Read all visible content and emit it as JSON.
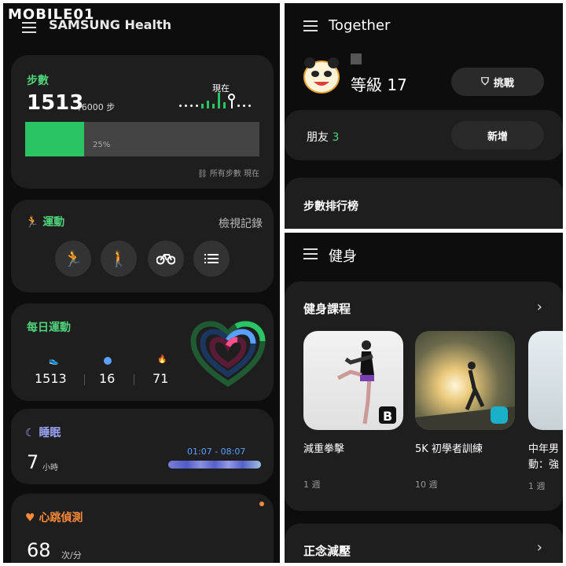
{
  "watermark": "MOBILE01",
  "left": {
    "brand": "SAMSUNG Health",
    "steps": {
      "title": "步數",
      "count": "1513",
      "goal": "/6000 步",
      "now_label": "現在",
      "progress": 0.25,
      "progress_label": "25%",
      "footer": "所有步數 現在"
    },
    "exercise": {
      "title": "運動",
      "link": "檢視記錄",
      "icons": [
        "running-icon",
        "walking-icon",
        "cycling-icon",
        "list-icon"
      ]
    },
    "daily": {
      "title": "每日運動",
      "steps": "1513",
      "minutes": "16",
      "calories": "71"
    },
    "sleep": {
      "title": "睡眠",
      "value": "7",
      "unit": "小時",
      "range": "01:07 - 08:07"
    },
    "heart": {
      "title": "心跳偵測",
      "value": "68",
      "unit": "次/分"
    }
  },
  "together": {
    "title": "Together",
    "level": "等級 17",
    "challenge": "挑戰",
    "friends_label": "朋友",
    "friends_count": "3",
    "add": "新增",
    "leaderboard": "步數排行榜"
  },
  "fitness": {
    "title": "健身",
    "section": "健身課程",
    "courses": [
      {
        "name": "減重拳擊",
        "duration": "1 週"
      },
      {
        "name": "5K 初學者訓練",
        "duration": "10 週"
      },
      {
        "name": "中年男",
        "name2": "動：強",
        "duration": "1 週"
      }
    ],
    "next_section": "正念減壓"
  },
  "colors": {
    "green": "#2ac465",
    "blue": "#5aa0ff",
    "pink": "#ff4f8a",
    "orange": "#ff8a3a",
    "sleep_purple": "#9fa6ff"
  }
}
